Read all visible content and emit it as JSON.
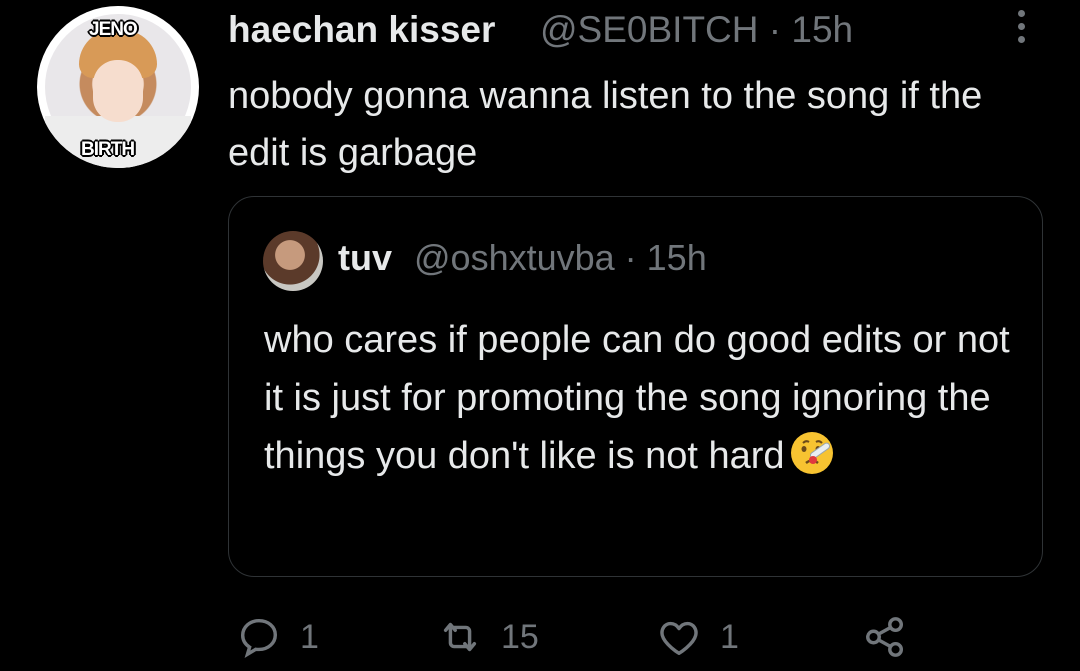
{
  "tweet": {
    "display_name": "haechan kisser",
    "handle_time": "@SE0BITCH · 15h",
    "avatar_sticker_top": "JENO",
    "avatar_sticker_bottom": "BIRTH",
    "text": "nobody gonna wanna listen to the song if the edit is garbage"
  },
  "quoted": {
    "display_name": "tuv",
    "handle_time": "@oshxtuvba · 15h",
    "text": "who cares if people can do good edits or not it is just for promoting the song ignoring the things you don't like is not hard",
    "emoji": "face-with-thermometer"
  },
  "actions": {
    "reply_count": "1",
    "retweet_count": "15",
    "like_count": "1"
  },
  "icons": [
    "more-icon",
    "reply-icon",
    "retweet-icon",
    "like-icon",
    "share-icon"
  ],
  "colors": {
    "background": "#000000",
    "text": "#e7e9ea",
    "muted": "#71767b",
    "border": "#2f3336"
  }
}
